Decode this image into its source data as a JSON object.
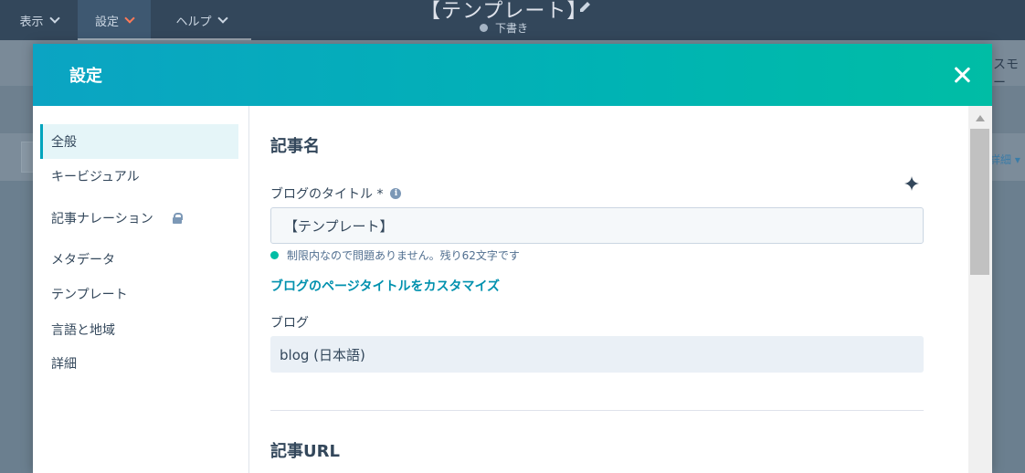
{
  "app": {
    "menus": [
      {
        "label": "表示"
      },
      {
        "label": "設定"
      },
      {
        "label": "ヘルプ"
      }
    ],
    "document_title": "【テンプレート】",
    "draft_status": "下書き",
    "right_partial_text": "スモー",
    "right_detail_text": "詳細 ▾"
  },
  "modal": {
    "title": "設定",
    "sidebar": {
      "items": [
        {
          "label": "全般"
        },
        {
          "label": "キービジュアル"
        },
        {
          "label": "記事ナレーション"
        },
        {
          "label": "メタデータ"
        },
        {
          "label": "テンプレート"
        },
        {
          "label": "言語と地域"
        },
        {
          "label": "詳細"
        }
      ]
    },
    "content": {
      "section_article_name": "記事名",
      "blog_title_label": "ブログのタイトル *",
      "blog_title_value": "【テンプレート】",
      "status_message": "制限内なので問題ありません。残り62文字です",
      "customize_link": "ブログのページタイトルをカスタマイズ",
      "blog_label": "ブログ",
      "blog_value": "blog (日本語)",
      "section_article_url": "記事URL"
    }
  },
  "colors": {
    "accent": "#00a4bd",
    "header_gradient_start": "#0ba4c3",
    "header_gradient_end": "#00bda5",
    "success": "#00bda5",
    "link": "#0091ae"
  }
}
